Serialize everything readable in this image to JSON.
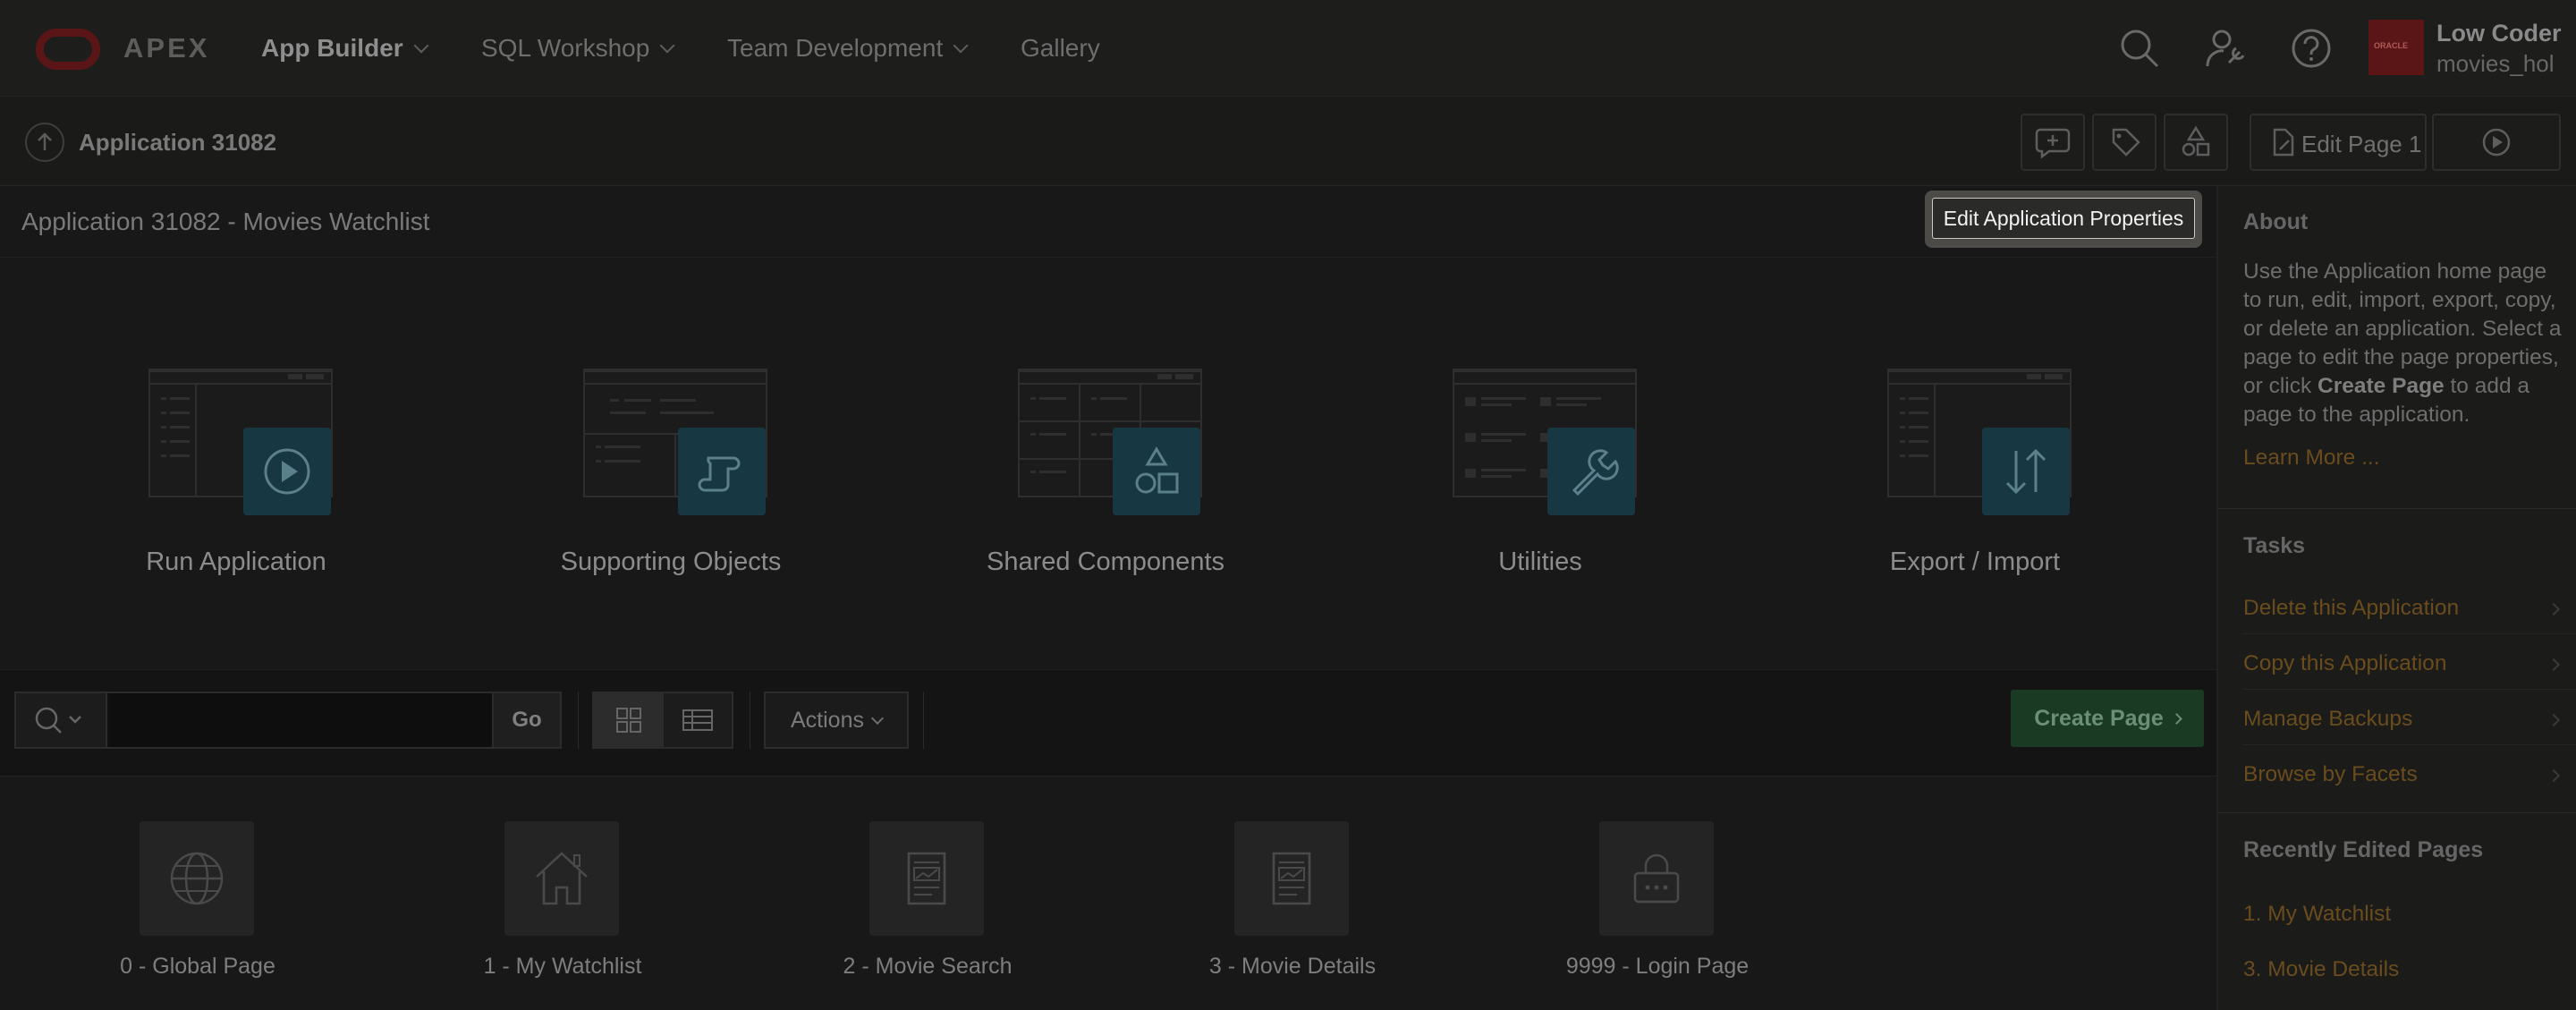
{
  "header": {
    "logo_text": "APEX",
    "menus": [
      {
        "label": "App Builder"
      },
      {
        "label": "SQL Workshop"
      },
      {
        "label": "Team Development"
      },
      {
        "label": "Gallery"
      }
    ],
    "user": {
      "name": "Low Coder",
      "workspace": "movies_hol",
      "avatar_text": "ORACLE"
    }
  },
  "breadcrumb": {
    "current": "Application 31082"
  },
  "toolbar_right": {
    "edit_page_label": "Edit Page 1"
  },
  "region": {
    "title": "Application 31082 - Movies Watchlist",
    "tooltip": "Edit Application Properties"
  },
  "big_tiles": [
    {
      "label": "Run Application",
      "icon": "play-icon"
    },
    {
      "label": "Supporting Objects",
      "icon": "scroll-icon"
    },
    {
      "label": "Shared Components",
      "icon": "shapes-icon"
    },
    {
      "label": "Utilities",
      "icon": "wrench-icon"
    },
    {
      "label": "Export / Import",
      "icon": "arrows-up-down-icon"
    }
  ],
  "search": {
    "placeholder": "",
    "go_label": "Go"
  },
  "actions_label": "Actions",
  "create_page_label": "Create Page",
  "pages": [
    {
      "label": "0 - Global Page",
      "icon": "globe-icon"
    },
    {
      "label": "1 - My Watchlist",
      "icon": "home-icon"
    },
    {
      "label": "2 - Movie Search",
      "icon": "page-icon"
    },
    {
      "label": "3 - Movie Details",
      "icon": "page-icon"
    },
    {
      "label": "9999 - Login Page",
      "icon": "lock-icon"
    }
  ],
  "sidebar": {
    "about_heading": "About",
    "about_text_1": "Use the Application home page to run, edit, import, export, copy, or delete an application. Select a page to edit the page properties, or click ",
    "about_text_bold": "Create Page",
    "about_text_2": " to add a page to the application.",
    "learn_more": "Learn More ...",
    "tasks_heading": "Tasks",
    "tasks": [
      {
        "label": "Delete this Application"
      },
      {
        "label": "Copy this Application"
      },
      {
        "label": "Manage Backups"
      },
      {
        "label": "Browse by Facets"
      }
    ],
    "recent_heading": "Recently Edited Pages",
    "recent": [
      {
        "label": "1. My Watchlist"
      },
      {
        "label": "3. Movie Details"
      }
    ]
  },
  "colors": {
    "accent_link": "#6a4c1d",
    "create_button": "#1a3a24",
    "tile_icon_bg": "#173843",
    "brand_red": "#5a1616"
  }
}
